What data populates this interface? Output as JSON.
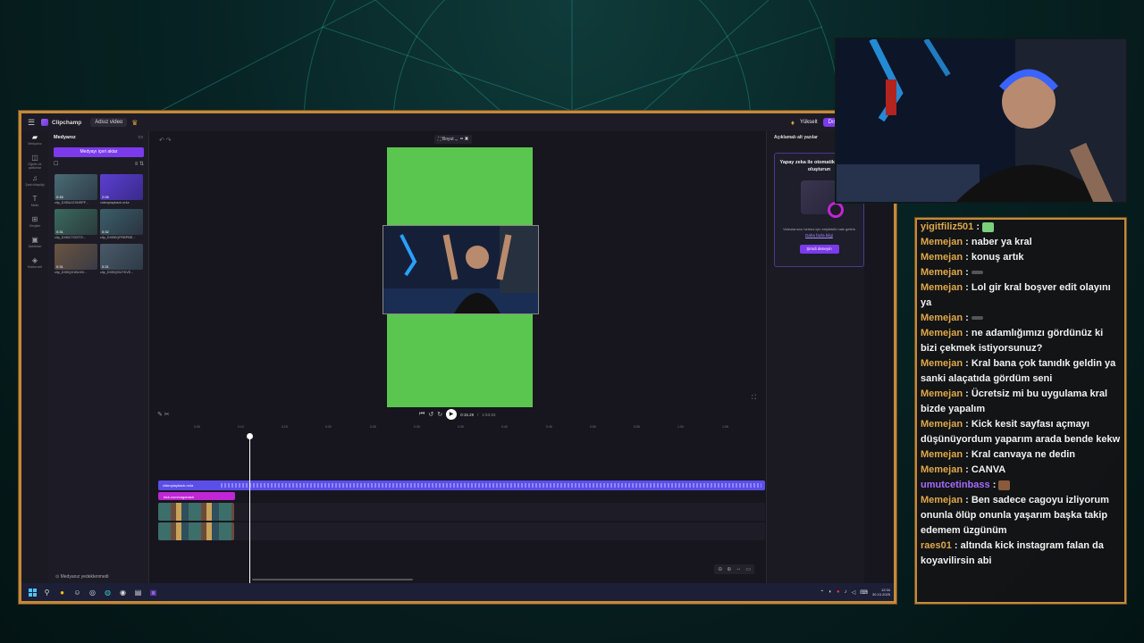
{
  "app": {
    "name": "Clipchamp",
    "project_name": "Adsız video",
    "upgrade_label": "Yükselt",
    "export_label": "Dışa aktar"
  },
  "leftbar": {
    "items": [
      {
        "label": "Medyanız"
      },
      {
        "label": "Öğeler ve şablonlar"
      },
      {
        "label": "Şarkı kitaplığı"
      },
      {
        "label": "Metin"
      },
      {
        "label": "Geçişler"
      },
      {
        "label": "Şablonlar"
      },
      {
        "label": "Marka seti"
      }
    ]
  },
  "media": {
    "title": "Medyanız",
    "import_label": "Medyayı içeri aktar",
    "backup_label": "Medyanız yedeklenmedi",
    "items": [
      {
        "duration": "0:45",
        "name": "clip_DXBUJZXNSPF..."
      },
      {
        "duration": "2:06",
        "name": "videoplayback.m4a"
      },
      {
        "duration": "0:31",
        "name": "clip_DXBCTOOTO..."
      },
      {
        "duration": "0:32",
        "name": "clip_DXBEQFRBPBE..."
      },
      {
        "duration": "0:31",
        "name": "clip_DXBQX1BLNV..."
      },
      {
        "duration": "0:31",
        "name": "clip_DXBQGUTKVE..."
      }
    ]
  },
  "stage": {
    "size_label": "Boyut"
  },
  "captions_panel": {
    "title": "Açıklamalı alt yazılar",
    "heading": "Yapay zeka ile otomatik alt yazılar oluşturun",
    "description": "Videolarınızı herkes için erişilebilir hale getirin",
    "link": "Daha fazla bilgi",
    "button": "Şimdi deneyin"
  },
  "player": {
    "current_time": "0:15.29",
    "total_time": "1:53.93",
    "ruler": [
      "0:05",
      "0:10",
      "0:15",
      "0:20",
      "0:25",
      "0:30",
      "0:35",
      "0:40",
      "0:45",
      "0:50",
      "0:55",
      "1:00",
      "1:05"
    ]
  },
  "timeline": {
    "audio_label": "videoplayback.m4a",
    "text_label": "kick.com/cagobasti"
  },
  "taskbar": {
    "time": "12:34",
    "date": "30.10.2025"
  },
  "chat": {
    "messages": [
      {
        "user": "yigitfiliz501",
        "text": ""
      },
      {
        "user": "Memejan",
        "text": "naber ya kral"
      },
      {
        "user": "Memejan",
        "text": "konuş artık"
      },
      {
        "user": "Memejan",
        "text": ""
      },
      {
        "user": "Memejan",
        "text": "Lol gir kral boşver edit olayını ya"
      },
      {
        "user": "Memejan",
        "text": ""
      },
      {
        "user": "Memejan",
        "text": "ne adamlığımızı gördünüz ki bizi çekmek istiyorsunuz?"
      },
      {
        "user": "Memejan",
        "text": "Kral bana çok tanıdık geldin ya sanki alaçatıda gördüm seni"
      },
      {
        "user": "Memejan",
        "text": "Ücretsiz mi bu uygulama kral bizde yapalım"
      },
      {
        "user": "Memejan",
        "text": "Kick kesit sayfası açmayı düşünüyordum yaparım arada bende kekw"
      },
      {
        "user": "Memejan",
        "text": "Kral canvaya ne dedin"
      },
      {
        "user": "Memejan",
        "text": "CANVA"
      },
      {
        "user": "umutcetinbass",
        "text": ""
      },
      {
        "user": "Memejan",
        "text": "Ben sadece cagoyu izliyorum onunla ölüp onunla yaşarım başka takip edemem üzgünüm"
      },
      {
        "user": "raes01",
        "text": "altında kick instagram falan da koyavilirsin abi"
      }
    ]
  },
  "colors": {
    "accent": "#7c3aed",
    "green_screen": "#5bc64f",
    "frame_gold": "#c38a3a",
    "chat_username": "#e0a84a"
  }
}
